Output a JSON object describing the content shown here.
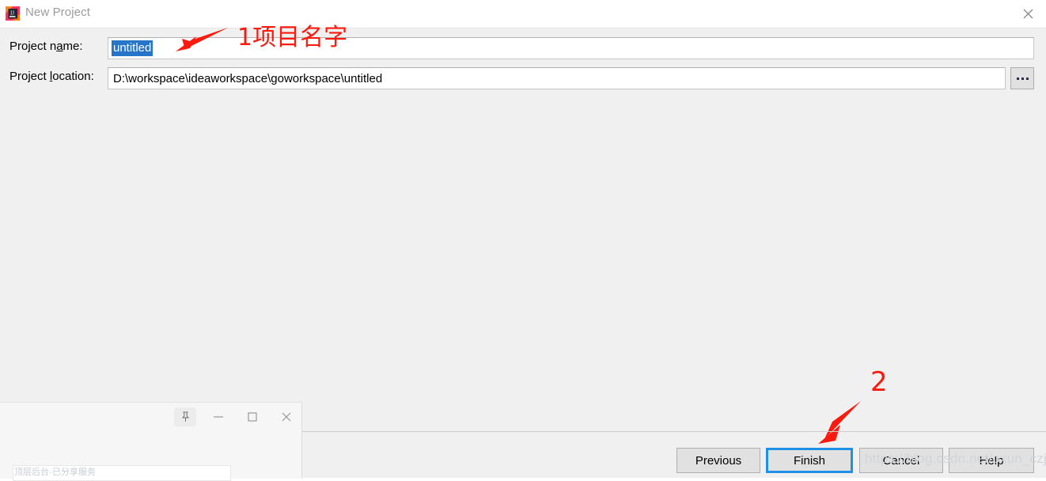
{
  "window": {
    "title": "New Project",
    "app_icon": "intellij-idea-icon",
    "close_icon": "close-icon"
  },
  "form": {
    "project_name": {
      "label_before": "Project n",
      "label_mnemonic": "a",
      "label_after": "me:",
      "value": "untitled",
      "selected": true,
      "selection_color": "#2675c8"
    },
    "project_location": {
      "label_before": "Project ",
      "label_mnemonic": "l",
      "label_after": "ocation:",
      "value": "D:\\workspace\\ideaworkspace\\goworkspace\\untitled"
    },
    "browse_button": {
      "label": "...",
      "icon": "ellipsis-icon"
    }
  },
  "annotations": {
    "marker_one": "1项目名字",
    "marker_two": "2",
    "color": "#fb1a0d",
    "arrow_one": "arrow-pointing-to-project-name",
    "arrow_two": "arrow-pointing-to-finish-button"
  },
  "footer": {
    "buttons": [
      {
        "label": "Previous",
        "name": "previous-button",
        "focused": false
      },
      {
        "label": "Finish",
        "name": "finish-button",
        "focused": true
      },
      {
        "label": "Cancel",
        "name": "cancel-button",
        "focused": false
      },
      {
        "label": "Help",
        "name": "help-button",
        "focused": false
      }
    ],
    "focus_color": "#1e90e8"
  },
  "watermark": {
    "text": "https://blog.csdn.net/oxun_czj"
  },
  "overlay_window": {
    "pin_icon": "pin-icon",
    "minimize_icon": "minimize-icon",
    "maximize_icon": "maximize-icon",
    "close_icon": "close-icon",
    "faded_text": "顶层后台-已分享服务"
  }
}
